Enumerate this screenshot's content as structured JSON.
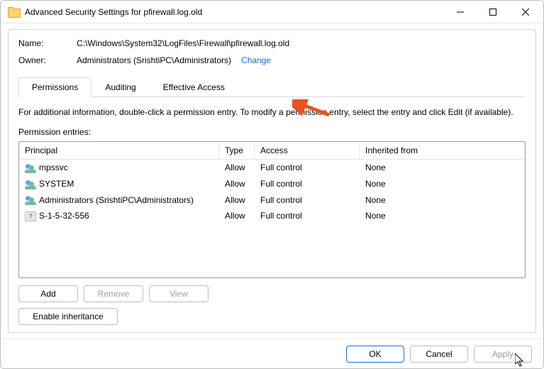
{
  "window": {
    "title": "Advanced Security Settings for pfirewall.log.old"
  },
  "header": {
    "name_label": "Name:",
    "name_value": "C:\\Windows\\System32\\LogFiles\\Firewall\\pfirewall.log.old",
    "owner_label": "Owner:",
    "owner_value": "Administrators (SrishtiPC\\Administrators)",
    "change_link": "Change"
  },
  "tabs": {
    "permissions": "Permissions",
    "auditing": "Auditing",
    "effective": "Effective Access"
  },
  "info_text": "For additional information, double-click a permission entry. To modify a permission entry, select the entry and click Edit (if available).",
  "subheading": "Permission entries:",
  "columns": {
    "principal": "Principal",
    "type": "Type",
    "access": "Access",
    "inherited": "Inherited from"
  },
  "entries": [
    {
      "icon": "two",
      "principal": "mpssvc",
      "type": "Allow",
      "access": "Full control",
      "inherited": "None"
    },
    {
      "icon": "two",
      "principal": "SYSTEM",
      "type": "Allow",
      "access": "Full control",
      "inherited": "None"
    },
    {
      "icon": "two",
      "principal": "Administrators (SrishtiPC\\Administrators)",
      "type": "Allow",
      "access": "Full control",
      "inherited": "None"
    },
    {
      "icon": "unk",
      "principal": "S-1-5-32-556",
      "type": "Allow",
      "access": "Full control",
      "inherited": "None"
    }
  ],
  "buttons": {
    "add": "Add",
    "remove": "Remove",
    "view": "View",
    "enable_inheritance": "Enable inheritance",
    "ok": "OK",
    "cancel": "Cancel",
    "apply": "Apply"
  }
}
